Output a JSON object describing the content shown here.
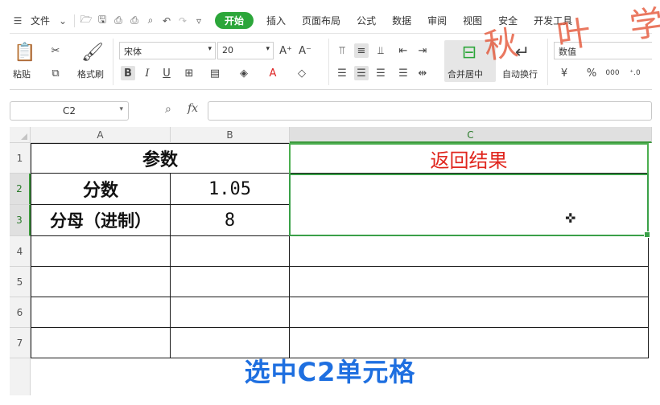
{
  "menu": {
    "file_label": "文件",
    "tabs": [
      "开始",
      "插入",
      "页面布局",
      "公式",
      "数据",
      "审阅",
      "视图",
      "安全",
      "开发工具"
    ],
    "active_tab": "开始"
  },
  "ribbon": {
    "paste_label": "粘贴",
    "format_painter_label": "格式刷",
    "font_name": "宋体",
    "font_size": "20",
    "merge_center_label": "合并居中",
    "wrap_text_label": "自动换行",
    "number_format": "数值",
    "bold": "B",
    "italic": "I",
    "underline": "U",
    "percent": "%",
    "thousands": "000",
    "dec_inc": "+.0\n.00",
    "dec_dec": "-.0\n.00"
  },
  "formula_bar": {
    "cell_ref": "C2",
    "fx_label": "fx",
    "formula": ""
  },
  "sheet": {
    "columns": [
      "A",
      "B",
      "C"
    ],
    "rows": [
      "1",
      "2",
      "3",
      "4",
      "5",
      "6",
      "7"
    ],
    "cells": {
      "A1": "参数",
      "C1": "返回结果",
      "A2": "分数",
      "B2": "1.05",
      "A3": "分母（进制）",
      "B3": "8"
    },
    "active_cell": "C2",
    "active_column": "C",
    "active_rows": [
      "2",
      "3"
    ]
  },
  "caption": "选中C2单元格",
  "watermark": "秋 叶 学",
  "colors": {
    "accent_green": "#2ca63a",
    "result_red": "#e0261e",
    "caption_blue": "#1e6fe0"
  }
}
